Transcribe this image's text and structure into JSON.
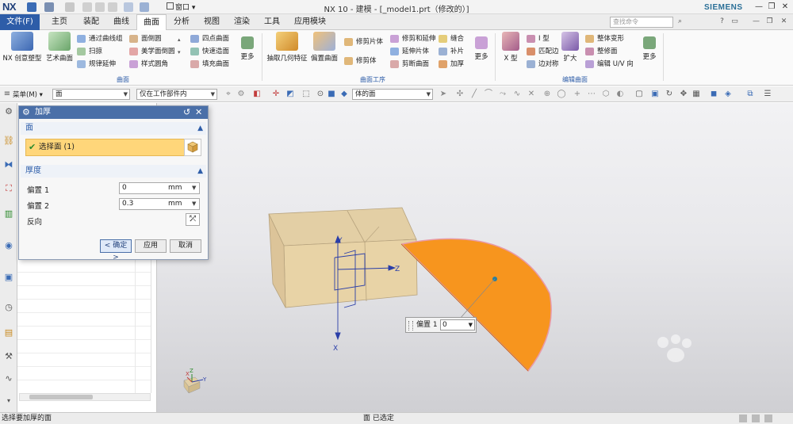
{
  "titlebar": {
    "logo": "NX",
    "window_menu": "窗口",
    "title": "NX 10 - 建模 - [_model1.prt（修改的）]",
    "brand": "SIEMENS"
  },
  "tabs": {
    "file": "文件(F)",
    "items": [
      "主页",
      "装配",
      "曲线",
      "曲面",
      "分析",
      "视图",
      "渲染",
      "工具",
      "应用模块"
    ],
    "active": "曲面",
    "search_placeholder": "查找命令"
  },
  "ribbon": {
    "group_surface": {
      "label": "曲面",
      "big": [
        "NX 创意塑型",
        "艺术曲面"
      ],
      "col1": [
        "通过曲线组",
        "扫掠",
        "规律延伸"
      ],
      "col2": [
        "面倒圆",
        "美学面倒圆",
        "样式圆角"
      ],
      "col3": [
        "四点曲面",
        "快速造面",
        "填充曲面"
      ],
      "more": "更多"
    },
    "group_ops": {
      "label": "曲面工序",
      "big": [
        "抽取几何特征",
        "偏置曲面"
      ],
      "col1": [
        "修剪片体",
        "修剪体"
      ],
      "col2": [
        "修剪和延伸",
        "延伸片体",
        "剪断曲面"
      ],
      "col3": [
        "缝合",
        "补片",
        "加厚"
      ],
      "more": "更多"
    },
    "group_edit": {
      "label": "编辑曲面",
      "big": [
        "X 型",
        "扩大"
      ],
      "col1": [
        "I 型",
        "匹配边",
        "边对称"
      ],
      "col2": [
        "整体变形",
        "整修面",
        "编辑 U/V 向"
      ],
      "more": "更多"
    }
  },
  "seltoolbar": {
    "menu": "菜单(M)",
    "filter_type": "面",
    "scope": "仅在工作部件内",
    "face_rule": "体的面"
  },
  "dialog": {
    "title": "加厚",
    "face_section": "面",
    "select_face": "选择面 (1)",
    "thickness_section": "厚度",
    "offset1_label": "偏置 1",
    "offset1_value": "0",
    "offset2_label": "偏置 2",
    "offset2_value": "0.3",
    "unit": "mm",
    "reverse_label": "反向",
    "ok": "< 确定 >",
    "apply": "应用",
    "cancel": "取消"
  },
  "viewport": {
    "offset_float_label": "偏置 1",
    "offset_float_value": "0",
    "axis_x": "X",
    "axis_y": "Y",
    "axis_z": "Z",
    "triad_x": "X",
    "triad_y": "Y",
    "triad_z": "Z"
  },
  "status": {
    "left": "选择要加厚的面",
    "mid": "面 已选定"
  },
  "colors": {
    "accent": "#2e5da8",
    "selection": "#ffd67a",
    "orange_face": "#f7951e",
    "block": "#e8d3a6"
  }
}
